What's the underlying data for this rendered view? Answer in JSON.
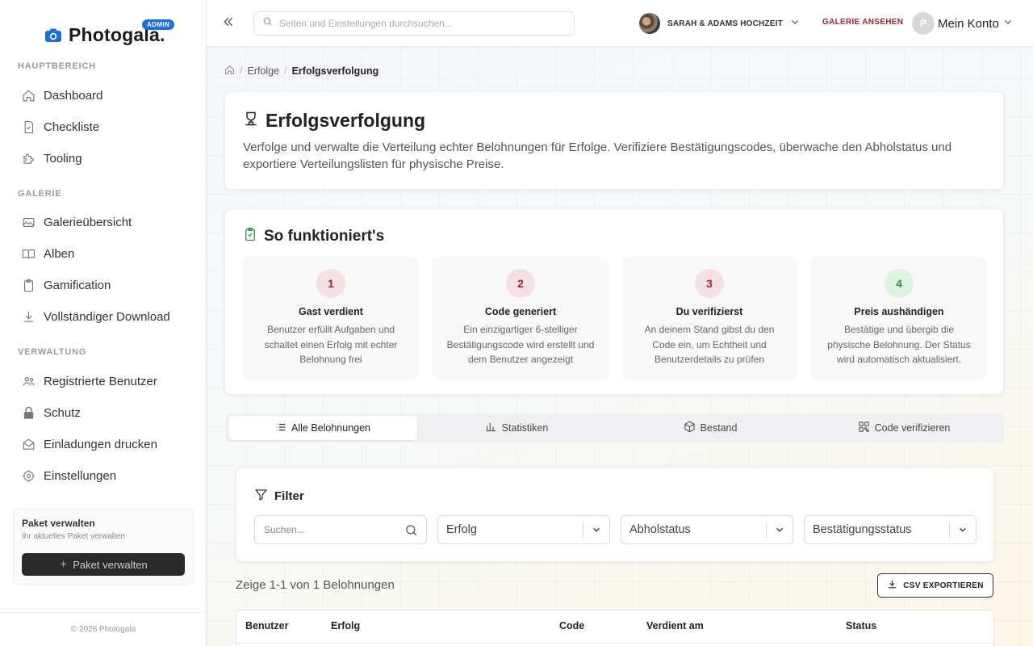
{
  "brand": {
    "name": "Photogala.",
    "badge": "ADMIN",
    "footer": "© 2026 Photogala"
  },
  "sidebar": {
    "sections": [
      {
        "label": "HAUPTBEREICH"
      },
      {
        "label": "GALERIE"
      },
      {
        "label": "VERWALTUNG"
      }
    ],
    "items": [
      {
        "label": "Dashboard",
        "icon": "home-icon"
      },
      {
        "label": "Checkliste",
        "icon": "checklist-icon"
      },
      {
        "label": "Tooling",
        "icon": "puzzle-icon"
      },
      {
        "label": "Galerieübersicht",
        "icon": "image-icon"
      },
      {
        "label": "Alben",
        "icon": "book-icon"
      },
      {
        "label": "Gamification",
        "icon": "clipboard-icon"
      },
      {
        "label": "Vollständiger Download",
        "icon": "download-icon"
      },
      {
        "label": "Registrierte Benutzer",
        "icon": "users-icon"
      },
      {
        "label": "Schutz",
        "icon": "lock-icon"
      },
      {
        "label": "Einladungen drucken",
        "icon": "envelope-icon"
      },
      {
        "label": "Einstellungen",
        "icon": "gear-icon"
      }
    ],
    "package": {
      "title": "Paket verwalten",
      "subtitle": "Ihr aktuelles Paket verwalten",
      "button": "Paket verwalten"
    }
  },
  "topbar": {
    "search_placeholder": "Seiten und Einstellungen durchsuchen...",
    "event_name": "SARAH & ADAMS HOCHZEIT",
    "gallery_link": "GALERIE ANSEHEN",
    "account_initial": "P",
    "account_label": "Mein Konto"
  },
  "breadcrumb": {
    "parent": "Erfolge",
    "current": "Erfolgsverfolgung"
  },
  "header": {
    "title": "Erfolgsverfolgung",
    "description": "Verfolge und verwalte die Verteilung echter Belohnungen für Erfolge. Verifiziere Bestätigungscodes, überwache den Abholstatus und exportiere Verteilungslisten für physische Preise."
  },
  "how": {
    "title": "So funktioniert's",
    "steps": [
      {
        "num": "1",
        "title": "Gast verdient",
        "text": "Benutzer erfüllt Aufgaben und schaltet einen Erfolg mit echter Belohnung frei"
      },
      {
        "num": "2",
        "title": "Code generiert",
        "text": "Ein einzigartiger 6-stelliger Bestätigungscode wird erstellt und dem Benutzer angezeigt"
      },
      {
        "num": "3",
        "title": "Du verifizierst",
        "text": "An deinem Stand gibst du den Code ein, um Echtheit und Benutzerdetails zu prüfen"
      },
      {
        "num": "4",
        "title": "Preis aushändigen",
        "text": "Bestätige und übergib die physische Belohnung. Der Status wird automatisch aktualisiert."
      }
    ]
  },
  "tabs": [
    {
      "label": "Alle Belohnungen",
      "icon": "list-icon",
      "active": true
    },
    {
      "label": "Statistiken",
      "icon": "bar-chart-icon",
      "active": false
    },
    {
      "label": "Bestand",
      "icon": "box-icon",
      "active": false
    },
    {
      "label": "Code verifizieren",
      "icon": "qr-code-icon",
      "active": false
    }
  ],
  "filter": {
    "title": "Filter",
    "search_placeholder": "Suchen...",
    "selects": [
      "Erfolg",
      "Abholstatus",
      "Bestätigungsstatus"
    ]
  },
  "results": {
    "count_text": "Zeige 1-1 von 1 Belohnungen",
    "export_label": "CSV EXPORTIEREN"
  },
  "table": {
    "columns": [
      "Benutzer",
      "Erfolg",
      "Code",
      "Verdient am",
      "Status"
    ]
  },
  "colors": {
    "accent": "#9c2330",
    "brand_blue": "#1f6fd8",
    "success": "#2f8f47"
  }
}
